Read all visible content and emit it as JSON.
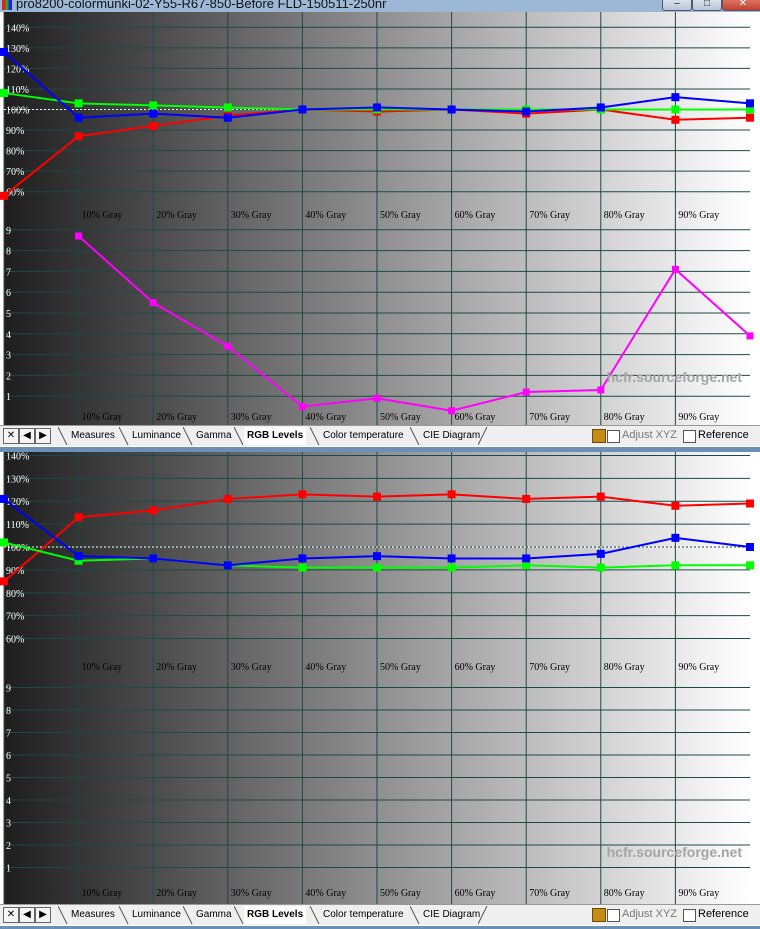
{
  "window": {
    "title": "pro8200-colormunki-02-Y55-R67-850-Before FLD-150511-250nr",
    "min_label": "–",
    "max_label": "□",
    "close_label": "✕"
  },
  "colors": {
    "red": "#ff0000",
    "green": "#00ff00",
    "blue": "#0000ff",
    "magenta": "#ff00ff",
    "grid": "#1d4a46",
    "tab_active_bg": "#ffffff"
  },
  "watermark": "hcfr.sourceforge.net",
  "tabs": [
    "Measures",
    "Luminance",
    "Gamma",
    "RGB Levels",
    "Color temperature",
    "CIE Diagram"
  ],
  "active_tab": "RGB Levels",
  "options": {
    "adjust_xyz_label": "Adjust XYZ",
    "reference_label": "Reference"
  },
  "panels": [
    {
      "chart_data": [
        {
          "type": "line",
          "x_tick_labels": [
            "10% Gray",
            "20% Gray",
            "30% Gray",
            "40% Gray",
            "50% Gray",
            "60% Gray",
            "70% Gray",
            "80% Gray",
            "90% Gray"
          ],
          "x": [
            0,
            10,
            20,
            30,
            40,
            50,
            60,
            70,
            80,
            90,
            100
          ],
          "y_tick_labels": [
            "140%",
            "130%",
            "120%",
            "110%",
            "100%",
            "90%",
            "80%",
            "70%",
            "60%"
          ],
          "ylim": [
            55,
            145
          ],
          "reference": 100,
          "series": [
            {
              "color": "red",
              "values": [
                58,
                87,
                92,
                97,
                100,
                99,
                100,
                98,
                100,
                95,
                96
              ]
            },
            {
              "color": "green",
              "values": [
                108,
                103,
                102,
                101,
                100,
                100,
                100,
                100,
                100,
                100,
                100
              ]
            },
            {
              "color": "blue",
              "values": [
                128,
                96,
                98,
                96,
                100,
                101,
                100,
                99,
                101,
                106,
                103
              ]
            }
          ]
        },
        {
          "type": "line",
          "x_tick_labels": [
            "10% Gray",
            "20% Gray",
            "30% Gray",
            "40% Gray",
            "50% Gray",
            "60% Gray",
            "70% Gray",
            "80% Gray",
            "90% Gray"
          ],
          "x": [
            10,
            20,
            30,
            40,
            50,
            60,
            70,
            80,
            90,
            100
          ],
          "y_tick_labels": [
            "9",
            "8",
            "7",
            "6",
            "5",
            "4",
            "3",
            "2",
            "1"
          ],
          "ylim": [
            0,
            10
          ],
          "series": [
            {
              "color": "magenta",
              "values": [
                8.7,
                5.5,
                3.4,
                0.5,
                0.9,
                0.3,
                1.2,
                1.3,
                7.1,
                3.9
              ]
            }
          ]
        }
      ]
    },
    {
      "chart_data": [
        {
          "type": "line",
          "x_tick_labels": [
            "10% Gray",
            "20% Gray",
            "30% Gray",
            "40% Gray",
            "50% Gray",
            "60% Gray",
            "70% Gray",
            "80% Gray",
            "90% Gray"
          ],
          "x": [
            0,
            10,
            20,
            30,
            40,
            50,
            60,
            70,
            80,
            90,
            100
          ],
          "y_tick_labels": [
            "140%",
            "130%",
            "120%",
            "110%",
            "100%",
            "90%",
            "80%",
            "70%",
            "60%"
          ],
          "ylim": [
            55,
            145
          ],
          "reference": 100,
          "series": [
            {
              "color": "red",
              "values": [
                85,
                113,
                116,
                121,
                123,
                122,
                123,
                121,
                122,
                118,
                119
              ]
            },
            {
              "color": "green",
              "values": [
                102,
                94,
                95,
                92,
                91,
                91,
                91,
                92,
                91,
                92,
                92
              ]
            },
            {
              "color": "blue",
              "values": [
                121,
                96,
                95,
                92,
                95,
                96,
                95,
                95,
                97,
                104,
                100
              ]
            }
          ]
        },
        {
          "type": "line",
          "x_tick_labels": [
            "10% Gray",
            "20% Gray",
            "30% Gray",
            "40% Gray",
            "50% Gray",
            "60% Gray",
            "70% Gray",
            "80% Gray",
            "90% Gray"
          ],
          "x": [
            10,
            20,
            30,
            40,
            50,
            60,
            70,
            80,
            90,
            100
          ],
          "y_tick_labels": [
            "9",
            "8",
            "7",
            "6",
            "5",
            "4",
            "3",
            "2",
            "1"
          ],
          "ylim": [
            0,
            10
          ],
          "series": []
        }
      ]
    }
  ]
}
